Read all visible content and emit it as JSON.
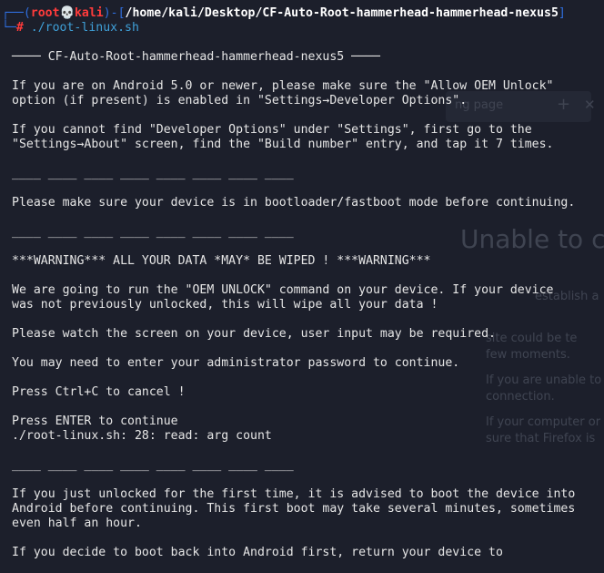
{
  "background": {
    "tab_label": "ng page",
    "tab_plus": "+",
    "tab_close": "✕",
    "heading": "Unable to co",
    "bullets": [
      "establish a",
      "site could be te",
      "few moments.",
      "If you are unable to",
      "connection.",
      "If your computer or",
      "sure that Firefox is"
    ]
  },
  "prompt": {
    "open_bracket": "┌──(",
    "user": "root",
    "skull": "💀",
    "host": "kali",
    "mid": ")-[",
    "path": "/home/kali/Desktop/CF-Auto-Root-hammerhead-hammerhead-nexus5",
    "close_bracket": "]",
    "second_prefix": "└─",
    "hash": "#",
    "command": "./root-linux.sh"
  },
  "output": {
    "header": "──── CF-Auto-Root-hammerhead-hammerhead-nexus5 ────",
    "lines": [
      "If you are on Android 5.0 or newer, please make sure the \"Allow OEM Unlock\"",
      "option (if present) is enabled in \"Settings→Developer Options\".",
      "",
      "If you cannot find \"Developer Options\" under \"Settings\", first go to the",
      "\"Settings→About\" screen, find the \"Build number\" entry, and tap it 7 times.",
      "",
      "____ ____ ____ ____ ____ ____ ____ ____",
      "",
      "Please make sure your device is in bootloader/fastboot mode before continuing.",
      "",
      "____ ____ ____ ____ ____ ____ ____ ____",
      "",
      "***WARNING*** ALL YOUR DATA *MAY* BE WIPED ! ***WARNING***",
      "",
      "We are going to run the \"OEM UNLOCK\" command on your device. If your device",
      "was not previously unlocked, this will wipe all your data !",
      "",
      "Please watch the screen on your device, user input may be required.",
      "",
      "You may need to enter your administrator password to continue.",
      "",
      "Press Ctrl+C to cancel !",
      "",
      "Press ENTER to continue",
      "./root-linux.sh: 28: read: arg count",
      "",
      "____ ____ ____ ____ ____ ____ ____ ____",
      "",
      "If you just unlocked for the first time, it is advised to boot the device into",
      "Android before continuing. This first boot may take several minutes, sometimes",
      "even half an hour.",
      "",
      "If you decide to boot back into Android first, return your device to"
    ]
  }
}
